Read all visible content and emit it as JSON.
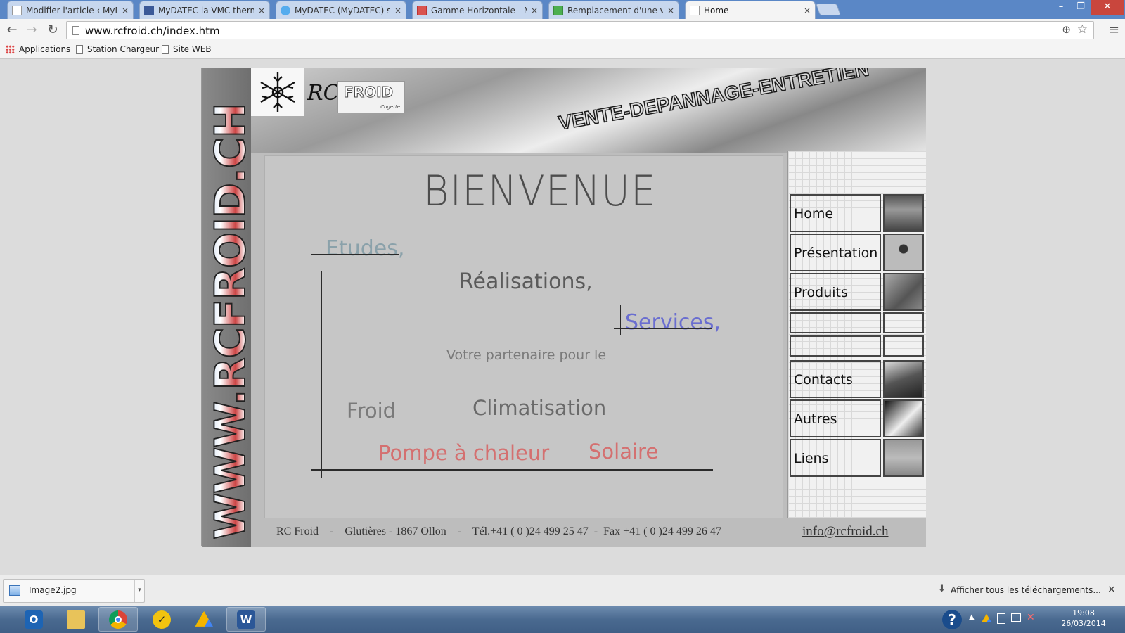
{
  "browser": {
    "tabs": [
      {
        "title": "Modifier l'article ‹ MyDate",
        "favicon": "page-icon",
        "active": false
      },
      {
        "title": "MyDATEC la VMC thermo",
        "favicon": "facebook-icon",
        "active": false
      },
      {
        "title": "MyDATEC (MyDATEC) sur",
        "favicon": "twitter-icon",
        "active": false
      },
      {
        "title": "Gamme Horizontale - My",
        "favicon": "site-icon",
        "active": false
      },
      {
        "title": "Remplacement d'une vent",
        "favicon": "link-icon",
        "active": false
      },
      {
        "title": "Home",
        "favicon": "page-icon",
        "active": true
      }
    ],
    "tab_close_glyph": "×",
    "window_controls": {
      "minimize": "–",
      "restore": "❐",
      "close": "✕"
    },
    "nav": {
      "back": "←",
      "forward": "→",
      "reload": "↻"
    },
    "url": "www.rcfroid.ch/index.htm",
    "zoom_icon": "⊕",
    "star_icon": "☆",
    "menu_icon": "≡",
    "bookmarks": [
      {
        "label": "Applications",
        "icon": "apps-grid-icon"
      },
      {
        "label": "Station Chargeur",
        "icon": "page-icon"
      },
      {
        "label": "Site WEB",
        "icon": "page-icon"
      }
    ]
  },
  "site": {
    "vertical_domain": "WWW.RCFROID.CH",
    "header": {
      "rc_mark": "RC",
      "brand": "FROID",
      "brand_sub": "Cogette",
      "tagline": "VENTE-DEPANNAGE-ENTRETIEN"
    },
    "main": {
      "title": "BIENVENUE",
      "words": {
        "etudes": "Etudes,",
        "realisations": "Réalisations,",
        "services": "Services,",
        "partner": "Votre partenaire pour le",
        "froid": "Froid",
        "climatisation": "Climatisation",
        "pompe": "Pompe à chaleur",
        "solaire": "Solaire"
      }
    },
    "nav": [
      {
        "label": "Home",
        "thumb": "building-thumbnail"
      },
      {
        "label": "Présentation",
        "thumb": "presentation-thumbnail"
      },
      {
        "label": "Produits",
        "thumb": "products-thumbnail"
      },
      {
        "label": "",
        "thumb": "empty"
      },
      {
        "label": "",
        "thumb": "empty"
      },
      {
        "label": "Contacts",
        "thumb": "calculator-thumbnail"
      },
      {
        "label": "Autres",
        "thumb": "other-thumbnail"
      },
      {
        "label": "Liens",
        "thumb": "links-thumbnail"
      }
    ],
    "footer": {
      "address": "RC Froid    -    Glutières - 1867 Ollon    -    Tél.+41 ( 0 )24 499 25 47  -  Fax +41 ( 0 )24 499 26 47",
      "email": "info@rcfroid.ch"
    }
  },
  "downloads": {
    "file": "Image2.jpg",
    "show_all": "Afficher tous les téléchargements...",
    "close": "×"
  },
  "taskbar": {
    "apps": [
      "outlook-icon",
      "file-explorer-icon",
      "chrome-icon",
      "norton-icon",
      "google-drive-icon",
      "word-icon"
    ],
    "time": "19:08",
    "date": "26/03/2014"
  },
  "colors": {
    "tab_strip": "#5a87c6",
    "etudes": "#8aa1aa",
    "services": "#6a6ed0",
    "pompe_solaire": "#d47070"
  }
}
